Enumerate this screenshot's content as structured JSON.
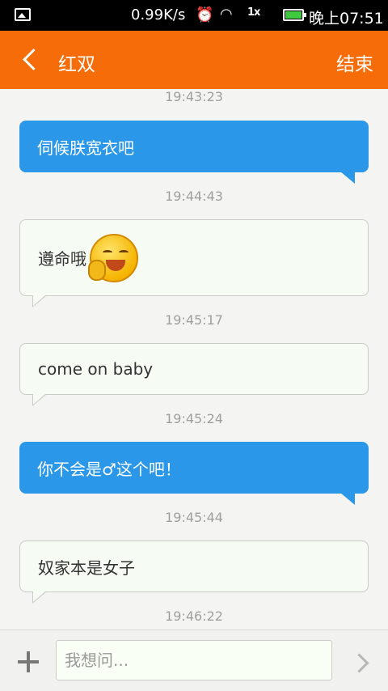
{
  "status_bar": {
    "speed": "0.99K/s",
    "alarm_icon": "alarm-icon",
    "wifi_icon": "wifi-icon",
    "signal": "1x",
    "time": "晚上07:51"
  },
  "header": {
    "title": "红双",
    "end_label": "结束"
  },
  "messages": [
    {
      "timestamp": "19:43:23",
      "sender": "me",
      "text": "伺候朕宽衣吧"
    },
    {
      "timestamp": "19:44:43",
      "sender": "other",
      "text": "遵命哦",
      "emoji": "embarrassed-laugh-emoji"
    },
    {
      "timestamp": "19:45:17",
      "sender": "other",
      "text": "come on baby"
    },
    {
      "timestamp": "19:45:24",
      "sender": "me",
      "text": "你不会是♂这个吧！"
    },
    {
      "timestamp": "19:45:44",
      "sender": "other",
      "text": "奴家本是女子"
    },
    {
      "timestamp": "19:46:22"
    }
  ],
  "input": {
    "placeholder": "我想问...",
    "value": ""
  },
  "colors": {
    "header": "#f56c08",
    "me_bubble": "#2b97e8",
    "other_bubble": "#f6fbf4"
  }
}
